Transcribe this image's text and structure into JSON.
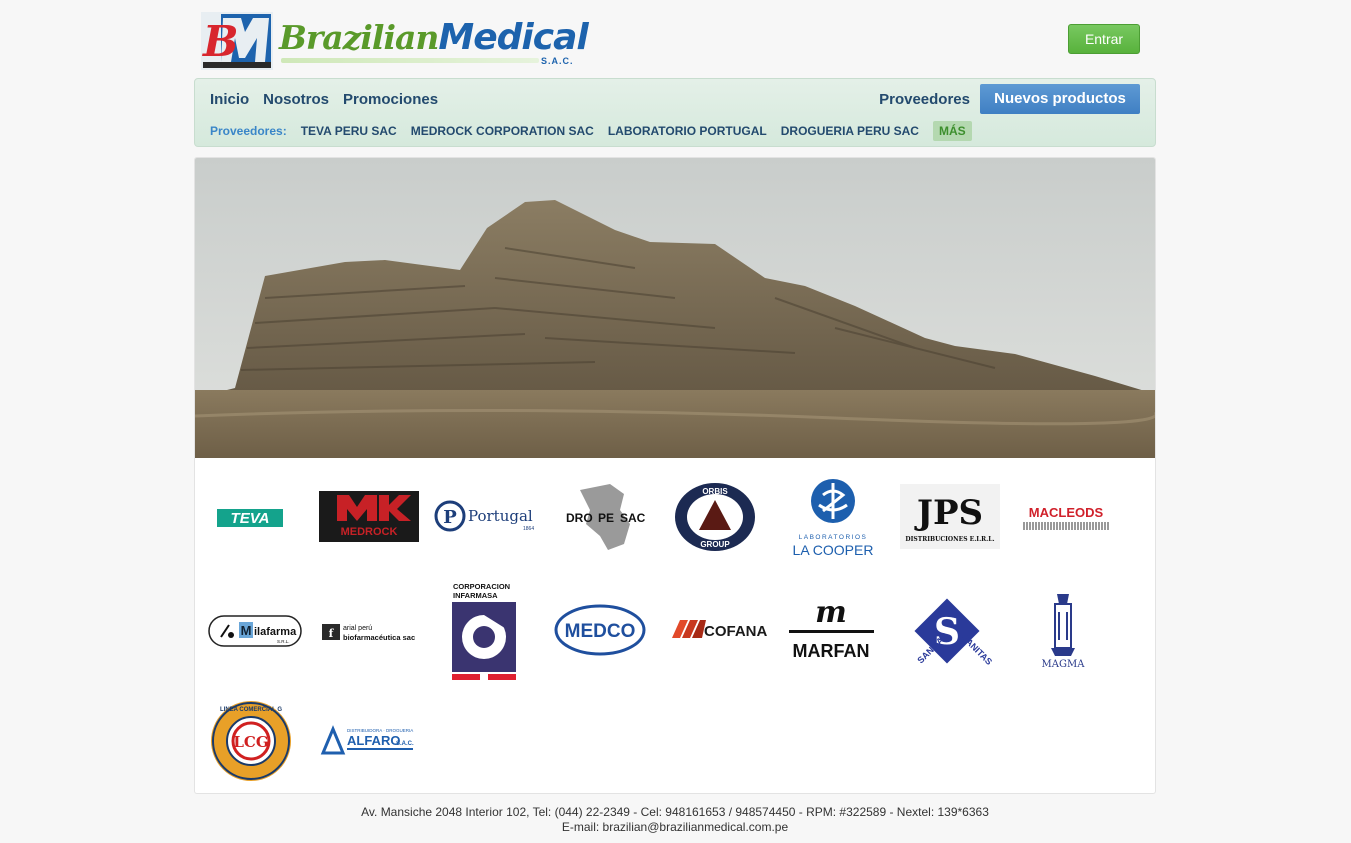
{
  "header": {
    "logo_initials": "BM",
    "logo_word_1": "Brazilian",
    "logo_word_2": "Medical",
    "logo_suffix": "S.A.C.",
    "login_label": "Entrar"
  },
  "nav": {
    "main": [
      "Inicio",
      "Nosotros",
      "Promociones"
    ],
    "providers_link": "Proveedores",
    "new_products": "Nuevos productos",
    "sub_label": "Proveedores:",
    "sub_items": [
      "TEVA PERU SAC",
      "MEDROCK CORPORATION SAC",
      "LABORATORIO PORTUGAL",
      "DROGUERIA PERU SAC"
    ],
    "more": "MÁS"
  },
  "logos": {
    "teva": "TEVA",
    "medrock": "MEDROCK",
    "portugal": "Portugal",
    "portugal_year": "1864",
    "dropesac": [
      "DRO",
      "PE",
      "SAC"
    ],
    "orbis": [
      "ORBIS",
      "GROUP"
    ],
    "lacooper_top": "LABORATORIOS",
    "lacooper": "LA COOPER",
    "jps": "JPS",
    "jps_sub": "DISTRIBUCIONES E.I.R.L.",
    "macleods": "MACLEODS",
    "milafarma": "ilafarma",
    "milafarma_sub": "S.R.L.",
    "biofarma_top": "arial perú",
    "biofarma": "biofarmacéutica sac",
    "infarmasa": [
      "CORPORACION",
      "INFARMASA"
    ],
    "medco": "MEDCO",
    "cofana": "COFANA",
    "marfan": "MARFAN",
    "sanitas": [
      "SANITAS",
      "SANITAS"
    ],
    "magma": "MAGMA",
    "lcg": "LCG",
    "lcg_ring": "LINEA COMERCIAL G",
    "alfaro_top": "DISTRIBUIDORA · DROGUERIA",
    "alfaro": "ALFARO",
    "alfaro_sac": "S.A.C."
  },
  "footer": {
    "line1": "Av. Mansiche 2048 Interior 102, Tel: (044) 22-2349 - Cel: 948161653 / 948574450 - RPM: #322589 - Nextel: 139*6363",
    "line2": "E-mail: brazilian@brazilianmedical.com.pe"
  },
  "colors": {
    "brand_blue": "#1d63ad",
    "brand_green": "#5a9a2a",
    "nav_text": "#234a6e",
    "login_green": "#58b23c",
    "new_products_blue": "#4a88c8"
  }
}
